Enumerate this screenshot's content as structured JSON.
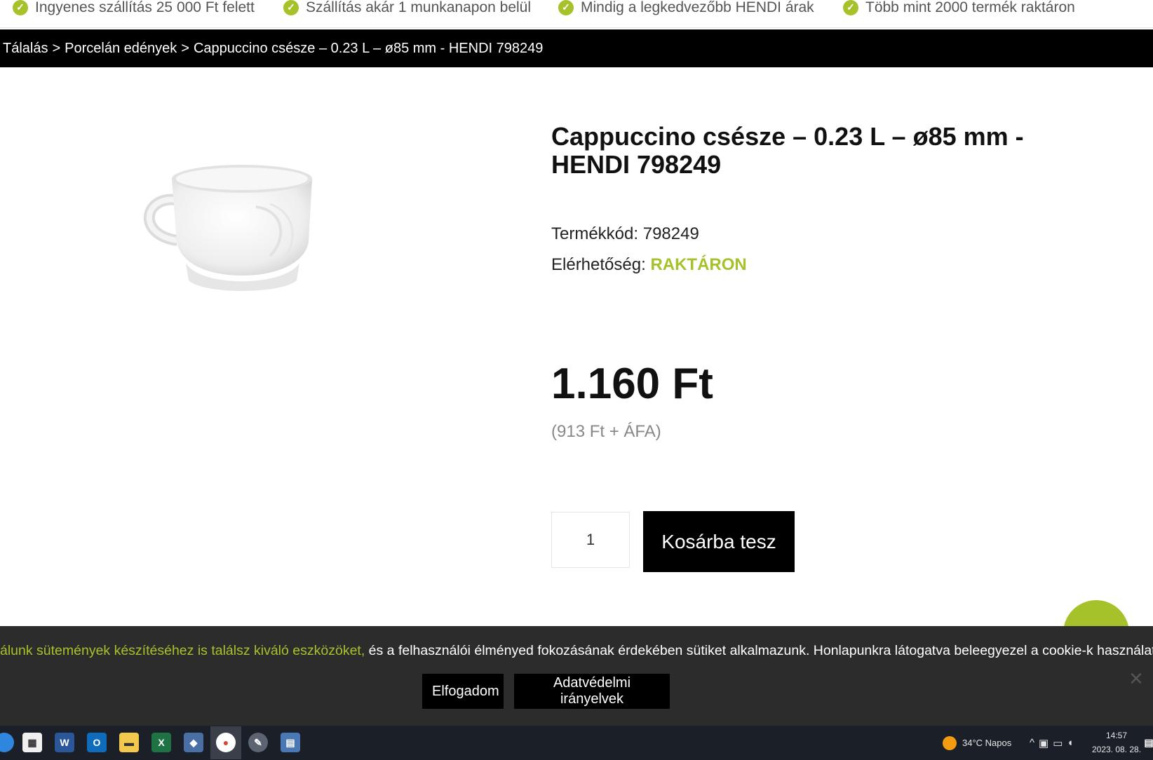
{
  "benefits": [
    {
      "icon": "check-icon",
      "text": "Ingyenes szállítás 25 000 Ft felett"
    },
    {
      "icon": "check-icon",
      "text": "Szállítás akár 1 munkanapon belül"
    },
    {
      "icon": "check-icon",
      "text": "Mindig a legkedvezőbb HENDI árak"
    },
    {
      "icon": "check-icon",
      "text": "Több mint 2000 termék raktáron"
    }
  ],
  "breadcrumb": {
    "items": [
      "Tálalás",
      "Porcelán edények",
      "Cappuccino csésze – 0.23 L – ø85 mm - HENDI 798249"
    ],
    "separator": ">"
  },
  "product": {
    "title": "Cappuccino csésze – 0.23 L – ø85 mm - HENDI 798249",
    "code_label": "Termékkód:",
    "code": "798249",
    "availability_label": "Elérhetőség:",
    "availability": "RAKTÁRON",
    "price": "1.160 Ft",
    "net_price": "(913 Ft + ÁFA)",
    "quantity": "1",
    "add_to_cart": "Kosárba tesz"
  },
  "cookie": {
    "text_highlight": "álunk sütemények készítéséhez is találsz kiváló eszközöket,",
    "text_rest": " és a felhasználói élményed fokozásának érdekében sütiket alkalmazunk. Honlapunkra látogatva beleegyezel a cookie-k használatába.",
    "accept": "Elfogadom",
    "privacy": "Adatvédelmi irányelvek",
    "close": "×"
  },
  "taskbar": {
    "weather": "34°C  Napos",
    "time": "14:57",
    "date": "2023. 08. 28."
  },
  "colors": {
    "accent": "#a6c22a",
    "dark": "#000000",
    "cookie_bg": "#2c2c2c",
    "taskbar_bg": "#1b1f27"
  }
}
